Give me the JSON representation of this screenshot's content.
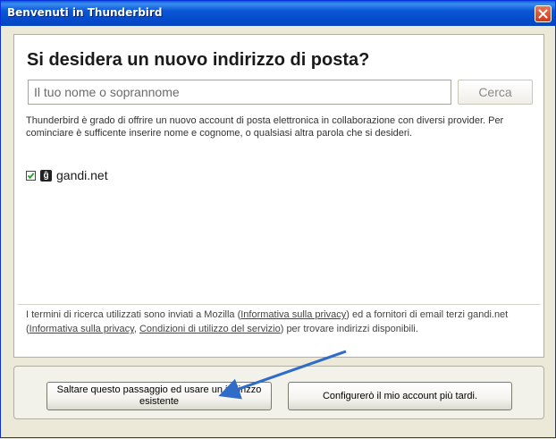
{
  "window": {
    "title": "Benvenuti in Thunderbird",
    "close_icon": "close-icon"
  },
  "main": {
    "heading": "Si desidera un nuovo indirizzo di posta?",
    "search": {
      "placeholder": "Il tuo nome o soprannome",
      "value": "",
      "button_label": "Cerca"
    },
    "intro_text": "Thunderbird è grado di offrire un nuovo account di posta elettronica in collaborazione con diversi provider. Per cominciare è sufficente inserire nome e cognome, o qualsiasi altra parola che si desideri.",
    "providers": [
      {
        "name": "gandi.net",
        "checked": true,
        "icon_glyph": "ĝ"
      }
    ],
    "footer": {
      "part1": "I termini di ricerca utilizzati sono inviati a Mozilla (",
      "link_mozilla_privacy": "Informativa sulla privacy",
      "part2": ") ed a fornitori di email terzi gandi.net (",
      "link_gandi_privacy": "Informativa sulla privacy",
      "part3": ", ",
      "link_terms": "Condizioni di utilizzo del servizio",
      "part4": ") per trovare indirizzi disponibili."
    }
  },
  "buttons": {
    "skip_label": "Saltare questo passaggio ed usare un indirizzo esistente",
    "later_label": "Configurerò il mio account più tardi."
  },
  "colors": {
    "titlebar": "#0a57d6",
    "annotation_arrow": "#2f6bc9",
    "checkbox_check": "#21a121"
  }
}
